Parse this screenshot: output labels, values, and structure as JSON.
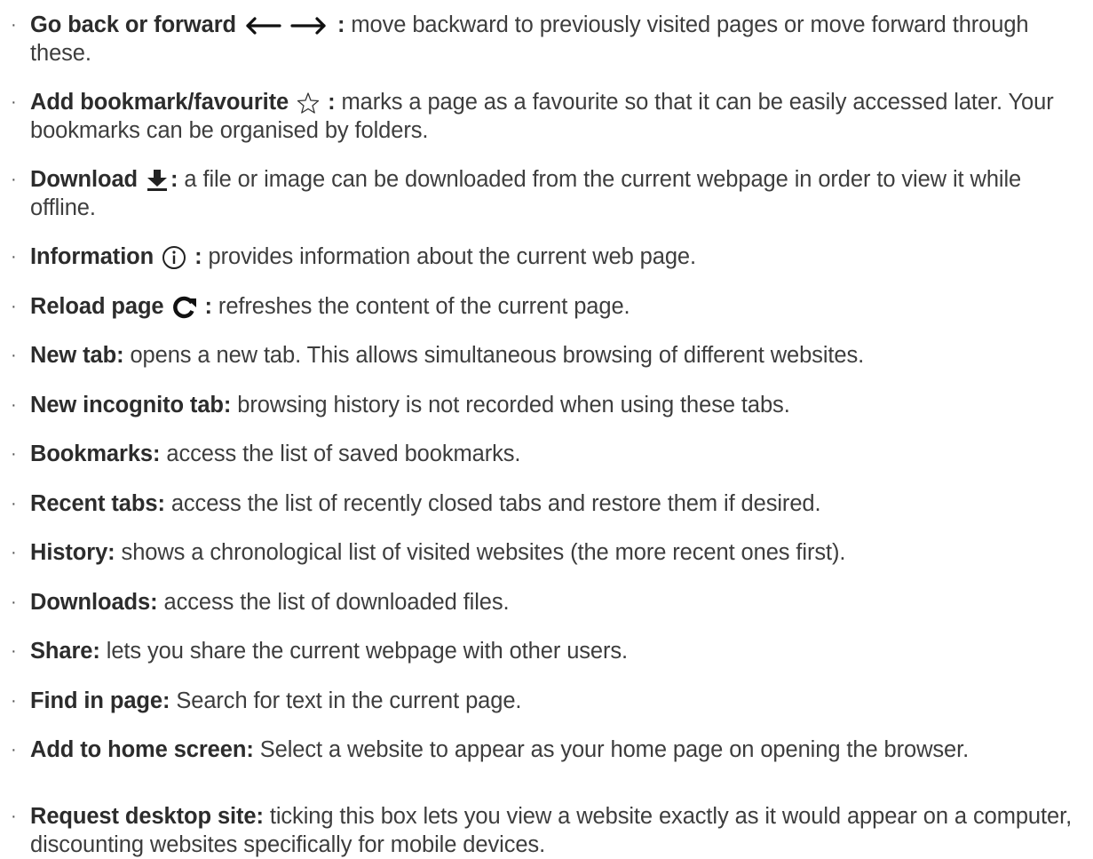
{
  "items": [
    {
      "term": "Go back or forward",
      "sep": ":",
      "desc": " move backward to previously visited pages or move forward through these.",
      "icon": "back-forward-arrows-icon"
    },
    {
      "term": "Add bookmark/favourite",
      "sep": ":",
      "desc": " marks a page as a favourite so that it can be easily accessed later. Your bookmarks can be organised by folders.",
      "icon": "star-icon"
    },
    {
      "term": "Download",
      "sep": ":",
      "desc": " a file or image can be downloaded from the current webpage in order to view it while offline.",
      "icon": "download-icon"
    },
    {
      "term": "Information",
      "sep": ":",
      "desc": " provides information about the current web page.",
      "icon": "info-icon"
    },
    {
      "term": "Reload page",
      "sep": ":",
      "desc": " refreshes the content of the current page.",
      "icon": "reload-icon"
    },
    {
      "term": "New tab:",
      "desc": " opens a new tab. This allows simultaneous browsing of different websites."
    },
    {
      "term": "New incognito tab:",
      "desc": " browsing history is not recorded when using these tabs."
    },
    {
      "term": "Bookmarks:",
      "desc": " access the list of saved bookmarks."
    },
    {
      "term": "Recent tabs:",
      "desc": " access the list of recently closed tabs and restore them if desired."
    },
    {
      "term": "History:",
      "desc": " shows a chronological list of visited websites (the more recent ones first)."
    },
    {
      "term": "Downloads:",
      "desc": " access the list of downloaded files."
    },
    {
      "term": "Share:",
      "desc": " lets you share the current webpage with other users."
    },
    {
      "term": "Find in page:",
      "desc": " Search for text in the current page."
    },
    {
      "term": "Add to home screen:",
      "desc": " Select a website to appear as your home page on opening the browser."
    },
    {
      "term": "Request desktop site:",
      "desc": " ticking this box lets you view a website exactly as it would appear on a computer, discounting websites specifically for mobile devices."
    }
  ],
  "bullet": "·"
}
